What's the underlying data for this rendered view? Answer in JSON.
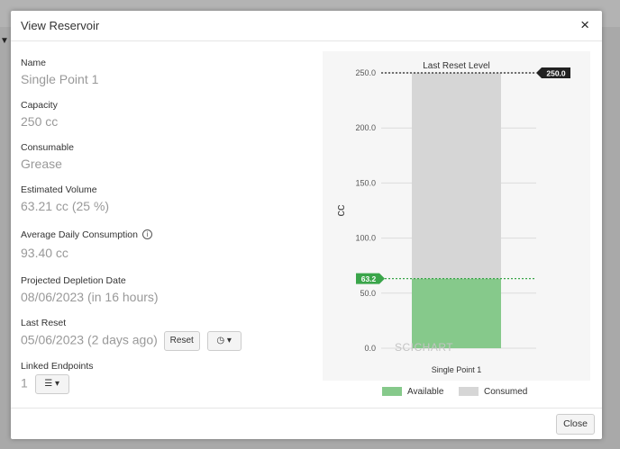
{
  "dialog": {
    "title": "View Reservoir",
    "close_symbol": "×",
    "close_label": "Close"
  },
  "fields": {
    "name": {
      "label": "Name",
      "value": "Single Point 1"
    },
    "capacity": {
      "label": "Capacity",
      "value": "250 cc"
    },
    "consumable": {
      "label": "Consumable",
      "value": "Grease"
    },
    "estimated_volume": {
      "label": "Estimated Volume",
      "value": "63.21 cc (25 %)"
    },
    "avg_daily": {
      "label": "Average Daily Consumption",
      "value": "93.40 cc",
      "info_symbol": "i"
    },
    "projected_depletion": {
      "label": "Projected Depletion Date",
      "value": "08/06/2023 (in 16 hours)"
    },
    "last_reset": {
      "label": "Last Reset",
      "value": "05/06/2023 (2 days ago)",
      "reset_label": "Reset",
      "history_symbol": "◷ ▾"
    },
    "linked_endpoints": {
      "label": "Linked Endpoints",
      "value": "1",
      "list_symbol": "☰ ▾"
    }
  },
  "chart_data": {
    "type": "bar",
    "categories": [
      "Single Point 1"
    ],
    "series": [
      {
        "name": "Available",
        "values": [
          63.2
        ],
        "color": "#86c98b"
      },
      {
        "name": "Consumed",
        "values": [
          186.8
        ],
        "color": "#d6d6d6"
      }
    ],
    "ylabel": "cc",
    "ylim": [
      0,
      250
    ],
    "yticks": [
      "0.0",
      "50.0",
      "100.0",
      "150.0",
      "200.0",
      "250.0"
    ],
    "annotations": [
      {
        "text": "Last Reset Level",
        "value": 250.0,
        "label": "250.0",
        "color": "#222222"
      },
      {
        "value": 63.2,
        "label": "63.2",
        "color": "#3aa54a"
      }
    ],
    "watermark": "SCICHART",
    "legend_position": "bottom"
  }
}
